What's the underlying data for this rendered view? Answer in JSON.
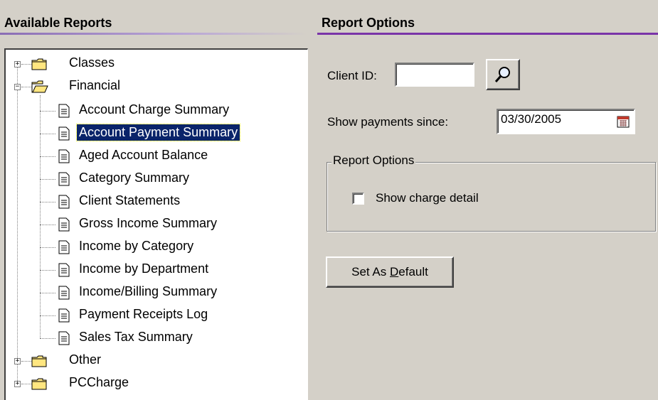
{
  "left_panel": {
    "title": "Available Reports",
    "tree": {
      "classes": "Classes",
      "financial": "Financial",
      "reports": [
        "Account Charge Summary",
        "Account Payment Summary",
        "Aged Account Balance",
        "Category Summary",
        "Client Statements",
        "Gross Income Summary",
        "Income by Category",
        "Income by Department",
        "Income/Billing Summary",
        "Payment Receipts Log",
        "Sales Tax Summary"
      ],
      "selected_report": "Account Payment Summary",
      "other": "Other",
      "pccharge": "PCCharge"
    }
  },
  "right_panel": {
    "title": "Report Options",
    "client_id_label": "Client ID:",
    "client_id_value": "",
    "show_payments_label": "Show payments since:",
    "show_payments_value": "03/30/2005",
    "group_title": "Report Options",
    "show_charge_detail_label": "Show charge detail",
    "show_charge_detail_checked": false,
    "set_default_prefix": "Set As ",
    "set_default_accel": "D",
    "set_default_suffix": "efault"
  },
  "icons": {
    "folder_closed": "folder-closed-icon",
    "folder_open": "folder-open-icon",
    "document": "document-icon",
    "search": "magnifier-icon",
    "calendar": "calendar-icon"
  },
  "colors": {
    "selection_bg": "#0a246a",
    "header_rule": "#7a34a8",
    "window_bg": "#d4d0c8"
  }
}
